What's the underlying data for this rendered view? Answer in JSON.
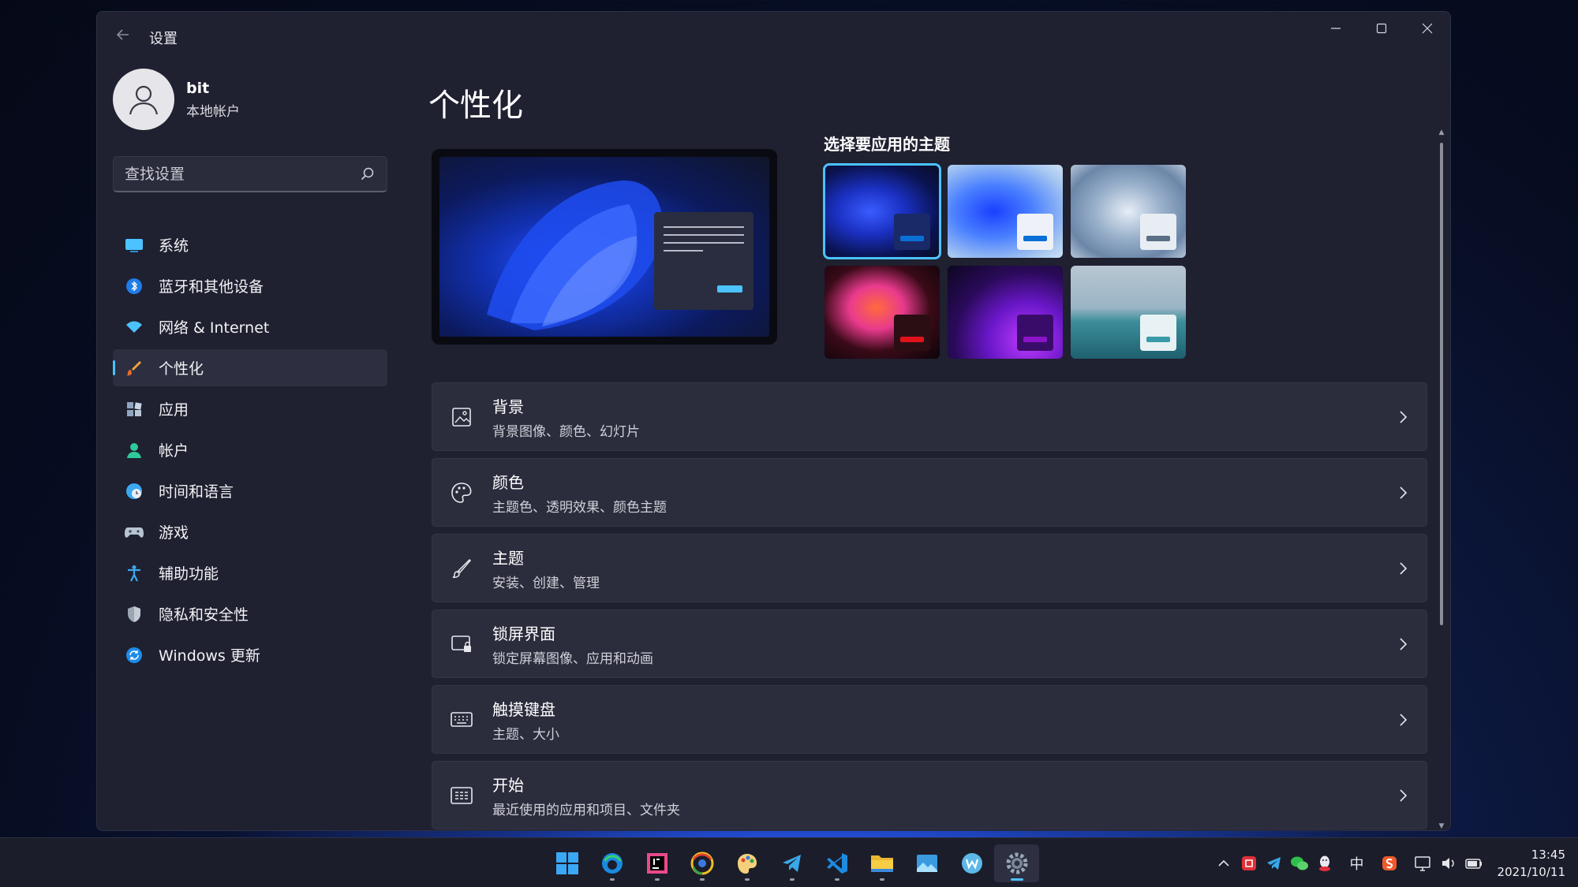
{
  "window": {
    "title": "设置"
  },
  "profile": {
    "name": "bit",
    "account_type": "本地帐户"
  },
  "search": {
    "placeholder": "查找设置"
  },
  "sidebar": {
    "items": [
      {
        "label": "系统",
        "icon": "monitor-icon"
      },
      {
        "label": "蓝牙和其他设备",
        "icon": "bluetooth-icon"
      },
      {
        "label": "网络 & Internet",
        "icon": "wifi-icon"
      },
      {
        "label": "个性化",
        "icon": "brush-icon",
        "active": true
      },
      {
        "label": "应用",
        "icon": "apps-icon"
      },
      {
        "label": "帐户",
        "icon": "person-icon"
      },
      {
        "label": "时间和语言",
        "icon": "globe-clock-icon"
      },
      {
        "label": "游戏",
        "icon": "gamepad-icon"
      },
      {
        "label": "辅助功能",
        "icon": "accessibility-icon"
      },
      {
        "label": "隐私和安全性",
        "icon": "shield-icon"
      },
      {
        "label": "Windows 更新",
        "icon": "update-icon"
      }
    ]
  },
  "main": {
    "title": "个性化",
    "themes_label": "选择要应用的主题",
    "themes": [
      {
        "name": "windows-dark",
        "selected": true,
        "bar_color": "#0a6fd6",
        "mini_color": "#1a2a68"
      },
      {
        "name": "windows-light",
        "bar_color": "#0a6fd6",
        "mini_color": "#eef2f8"
      },
      {
        "name": "glow",
        "bar_color": "#5a6e86",
        "mini_color": "#e8edf4"
      },
      {
        "name": "captured-motion",
        "bar_color": "#e0121c",
        "mini_color": "#2a0e14"
      },
      {
        "name": "sunrise",
        "bar_color": "#8a14c8",
        "mini_color": "#3a0c6a"
      },
      {
        "name": "flow",
        "bar_color": "#3a9aaa",
        "mini_color": "#e8f2f4"
      }
    ],
    "settings": [
      {
        "title": "背景",
        "subtitle": "背景图像、颜色、幻灯片",
        "icon": "image-icon"
      },
      {
        "title": "颜色",
        "subtitle": "主题色、透明效果、颜色主题",
        "icon": "palette-icon"
      },
      {
        "title": "主题",
        "subtitle": "安装、创建、管理",
        "icon": "brush-icon"
      },
      {
        "title": "锁屏界面",
        "subtitle": "锁定屏幕图像、应用和动画",
        "icon": "lock-screen-icon"
      },
      {
        "title": "触摸键盘",
        "subtitle": "主题、大小",
        "icon": "keyboard-icon"
      },
      {
        "title": "开始",
        "subtitle": "最近使用的应用和项目、文件夹",
        "icon": "start-icon"
      }
    ]
  },
  "taskbar": {
    "apps": [
      "start-icon",
      "edge-icon",
      "jetbrains-icon",
      "chrome-icon",
      "paint-icon",
      "telegram-icon",
      "vscode-icon",
      "file-explorer-icon",
      "photos-icon",
      "wps-icon",
      "settings-icon"
    ],
    "tray": {
      "ime": "中",
      "time": "13:45",
      "date": "2021/10/11"
    }
  },
  "colors": {
    "accent": "#4cc2ff",
    "window_bg": "#1f2030",
    "card_bg": "#2b2d3d"
  }
}
